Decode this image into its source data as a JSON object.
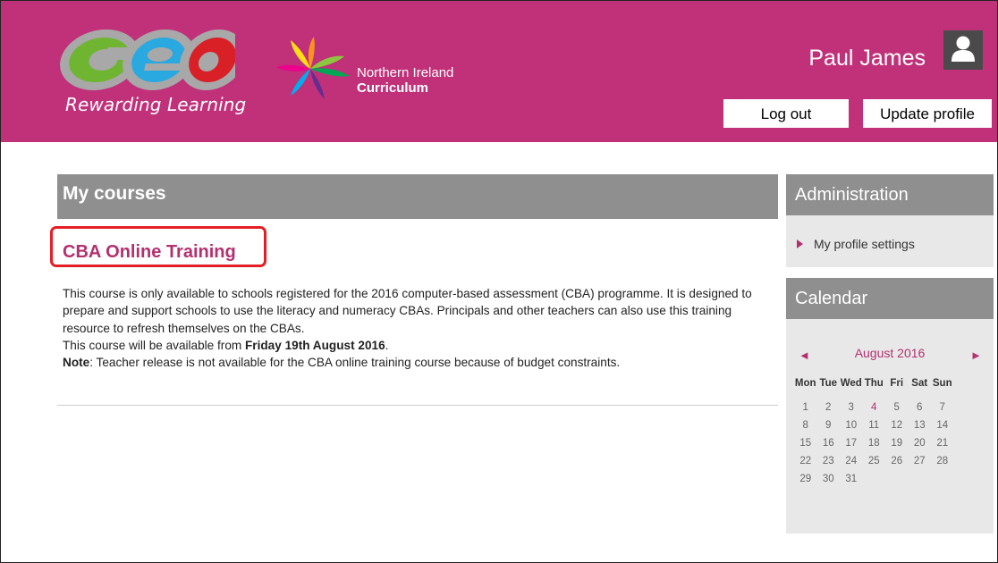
{
  "header": {
    "brand_tagline": "Rewarding Learning",
    "curriculum_line1": "Northern Ireland",
    "curriculum_line2": "Curriculum",
    "user_name": "Paul James",
    "logout_label": "Log out",
    "update_profile_label": "Update profile",
    "accent_color": "#c0317a"
  },
  "main": {
    "section_title": "My courses",
    "course": {
      "title": "CBA Online Training",
      "desc_line1": "This course is only available to schools registered for the 2016 computer-based assessment (CBA) programme. It is designed to prepare and support schools to use the literacy and numeracy CBAs. Principals and other teachers can also use this training resource to refresh themselves on the CBAs.",
      "avail_prefix": "This course will be available from ",
      "avail_date": "Friday 19th August 2016",
      "avail_suffix": ".",
      "note_label": "Note",
      "note_text": ": Teacher release is not available for the CBA online training course because of budget constraints."
    }
  },
  "sidebar": {
    "admin_title": "Administration",
    "admin_link": "My profile settings",
    "calendar_title": "Calendar",
    "calendar": {
      "month_label": "August 2016",
      "prev_icon": "◄",
      "next_icon": "►",
      "days": [
        "Mon",
        "Tue",
        "Wed",
        "Thu",
        "Fri",
        "Sat",
        "Sun"
      ],
      "weeks": [
        [
          "1",
          "2",
          "3",
          "4",
          "5",
          "6",
          "7"
        ],
        [
          "8",
          "9",
          "10",
          "11",
          "12",
          "13",
          "14"
        ],
        [
          "15",
          "16",
          "17",
          "18",
          "19",
          "20",
          "21"
        ],
        [
          "22",
          "23",
          "24",
          "25",
          "26",
          "27",
          "28"
        ],
        [
          "29",
          "30",
          "31",
          "",
          "",
          "",
          ""
        ]
      ],
      "highlight_day": "4"
    }
  }
}
